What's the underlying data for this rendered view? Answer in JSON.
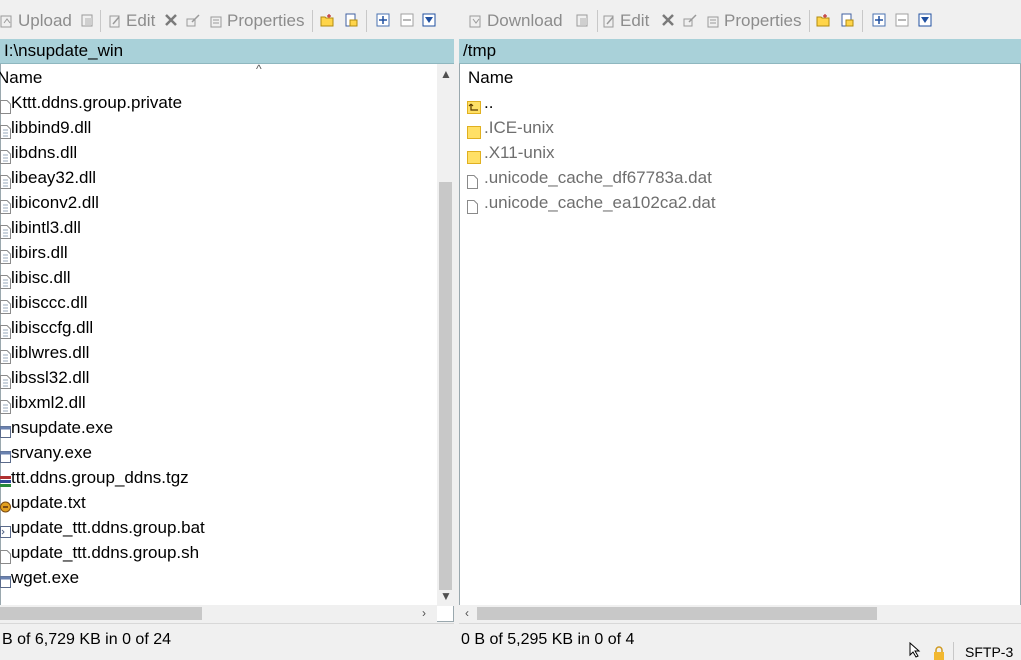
{
  "left": {
    "toolbar": {
      "upload_label": "Upload",
      "edit_label": "Edit",
      "properties_label": "Properties"
    },
    "path": "I:\\nsupdate_win",
    "column_name": "Name",
    "files": [
      {
        "name": "Kttt.ddns.group.private",
        "icon": "file-icon"
      },
      {
        "name": "libbind9.dll",
        "icon": "dll-file-icon"
      },
      {
        "name": "libdns.dll",
        "icon": "dll-file-icon"
      },
      {
        "name": "libeay32.dll",
        "icon": "dll-file-icon"
      },
      {
        "name": "libiconv2.dll",
        "icon": "dll-file-icon"
      },
      {
        "name": "libintl3.dll",
        "icon": "dll-file-icon"
      },
      {
        "name": "libirs.dll",
        "icon": "dll-file-icon"
      },
      {
        "name": "libisc.dll",
        "icon": "dll-file-icon"
      },
      {
        "name": "libisccc.dll",
        "icon": "dll-file-icon"
      },
      {
        "name": "libisccfg.dll",
        "icon": "dll-file-icon"
      },
      {
        "name": "liblwres.dll",
        "icon": "dll-file-icon"
      },
      {
        "name": "libssl32.dll",
        "icon": "dll-file-icon"
      },
      {
        "name": "libxml2.dll",
        "icon": "dll-file-icon"
      },
      {
        "name": "nsupdate.exe",
        "icon": "exe-file-icon"
      },
      {
        "name": "srvany.exe",
        "icon": "exe-file-icon"
      },
      {
        "name": "ttt.ddns.group_ddns.tgz",
        "icon": "archive-icon"
      },
      {
        "name": "update.txt",
        "icon": "text-file-icon"
      },
      {
        "name": "update_ttt.ddns.group.bat",
        "icon": "batch-file-icon"
      },
      {
        "name": "update_ttt.ddns.group.sh",
        "icon": "file-icon"
      },
      {
        "name": "wget.exe",
        "icon": "exe-file-icon"
      }
    ],
    "status": "B of 6,729 KB in 0 of 24"
  },
  "right": {
    "toolbar": {
      "download_label": "Download",
      "edit_label": "Edit",
      "properties_label": "Properties"
    },
    "path": "/tmp",
    "column_name": "Name",
    "files": [
      {
        "name": "..",
        "icon": "parent-folder-icon"
      },
      {
        "name": ".ICE-unix",
        "icon": "folder-icon"
      },
      {
        "name": ".X11-unix",
        "icon": "folder-icon"
      },
      {
        "name": ".unicode_cache_df67783a.dat",
        "icon": "file-icon"
      },
      {
        "name": ".unicode_cache_ea102ca2.dat",
        "icon": "file-icon"
      }
    ],
    "status": "0 B of 5,295 KB in 0 of 4"
  },
  "statusbar_right": "SFTP-3",
  "colors": {
    "path_bar": "#a9d1d9",
    "folder": "#ffe066",
    "disabled_text": "#8c8c8c",
    "hidden_file_text": "#6e6e6e"
  }
}
